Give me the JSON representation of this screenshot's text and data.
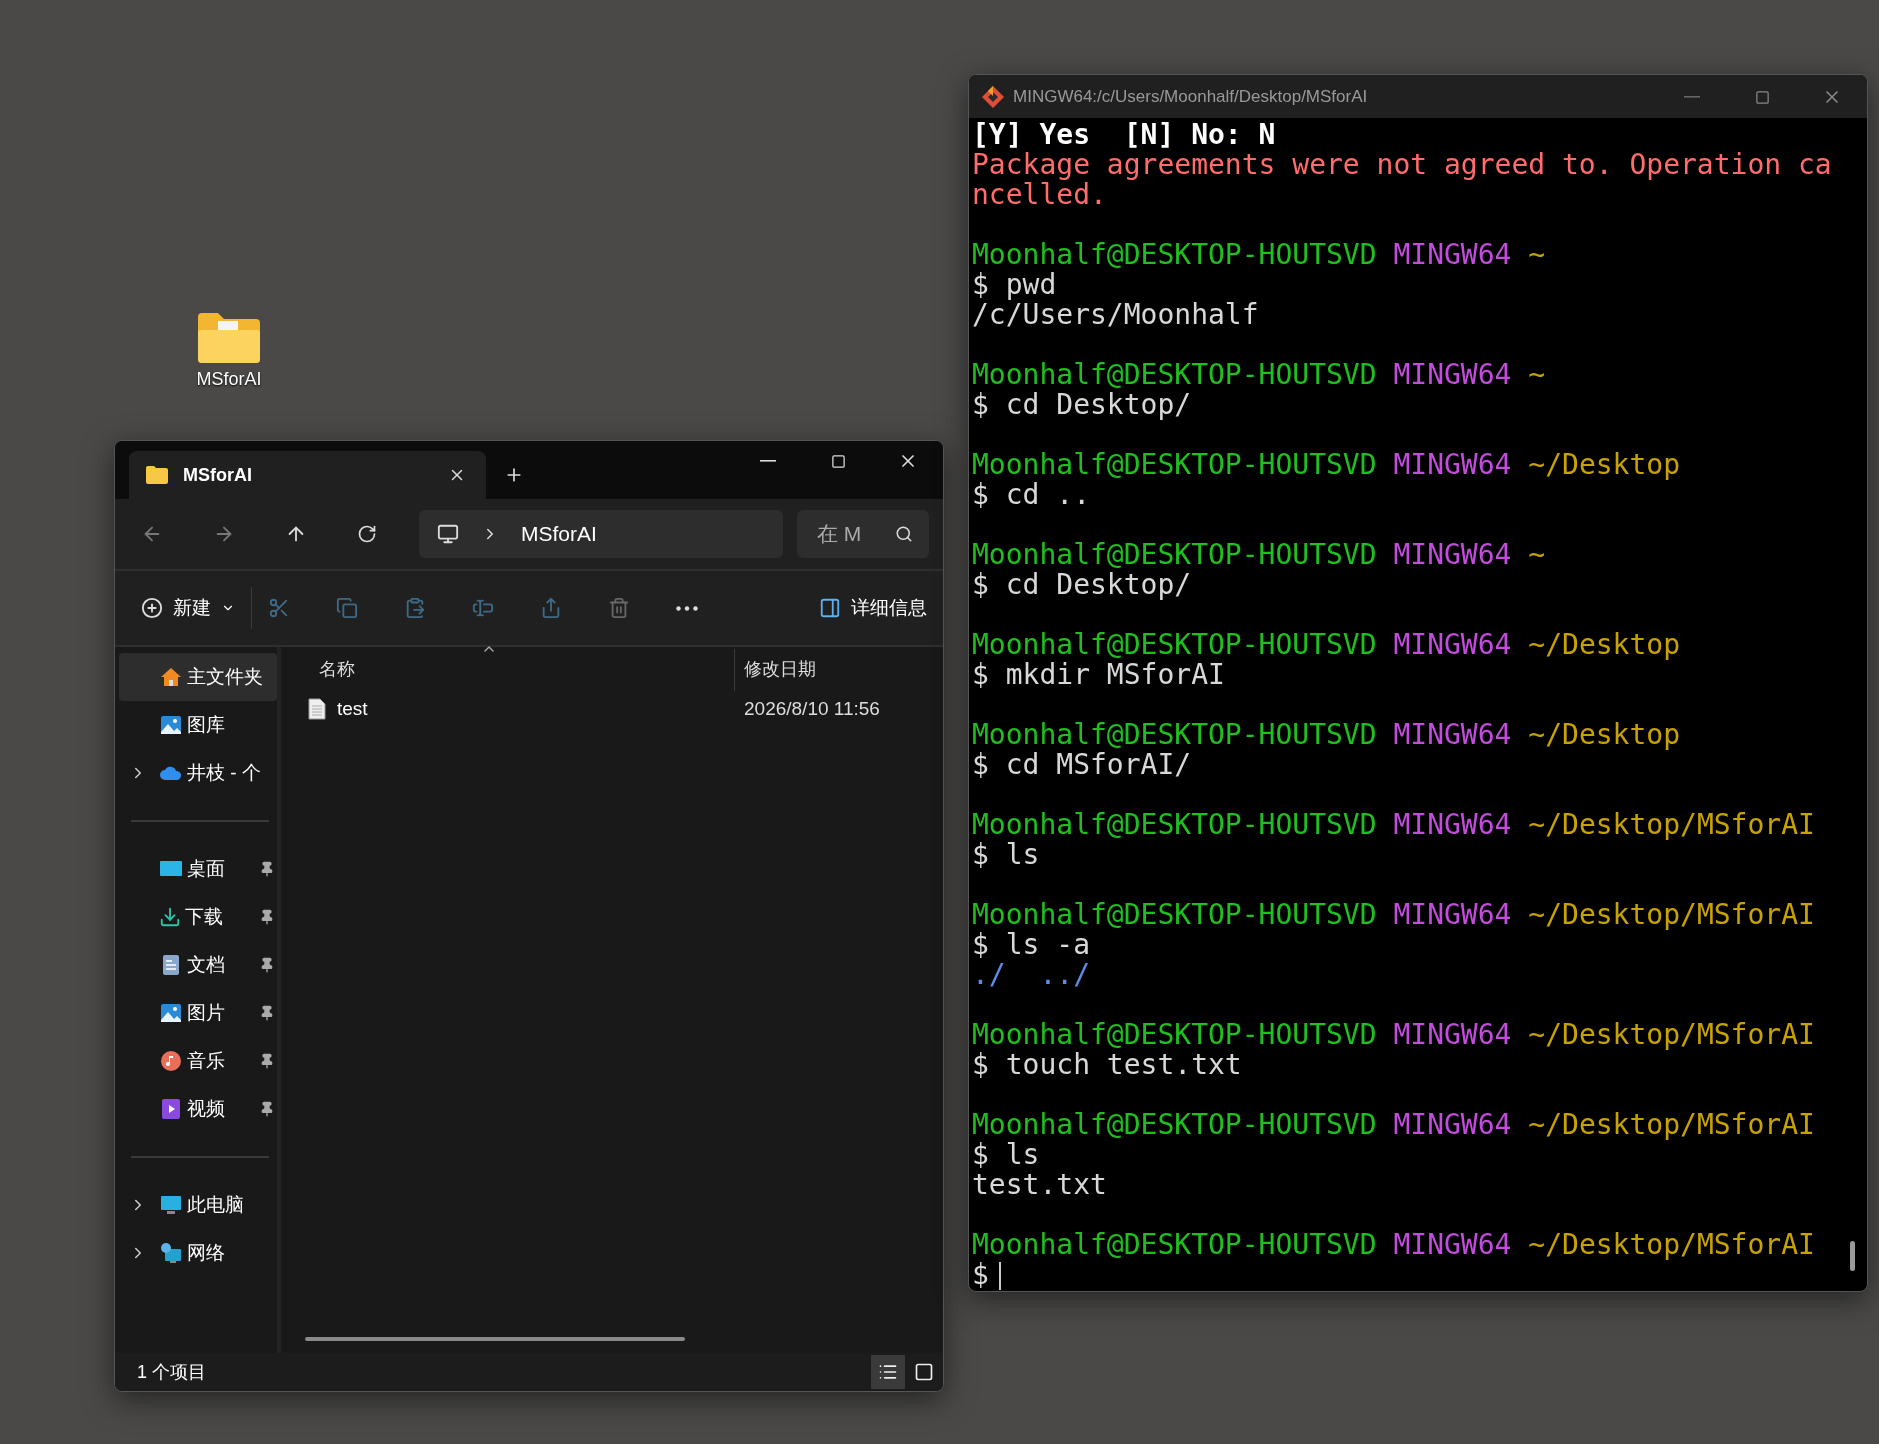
{
  "desktop": {
    "icons": [
      {
        "label": "MSforAI"
      }
    ]
  },
  "explorer": {
    "tabs": [
      {
        "label": "MSforAI",
        "selected": true
      }
    ],
    "address": {
      "crumbs": [
        "MSforAI"
      ]
    },
    "search": {
      "placeholder": "在 M"
    },
    "toolbar": {
      "new_label": "新建",
      "details_label": "详细信息"
    },
    "sidebar": [
      {
        "label": "主文件夹",
        "selected": true,
        "pinned": false,
        "has_children": false
      },
      {
        "label": "图库",
        "selected": false,
        "pinned": false,
        "has_children": false
      },
      {
        "label": "井枝 - 个",
        "selected": false,
        "pinned": false,
        "has_children": true
      },
      {
        "label": "桌面",
        "selected": false,
        "pinned": true,
        "has_children": false
      },
      {
        "label": "下载",
        "selected": false,
        "pinned": true,
        "has_children": false
      },
      {
        "label": "文档",
        "selected": false,
        "pinned": true,
        "has_children": false
      },
      {
        "label": "图片",
        "selected": false,
        "pinned": true,
        "has_children": false
      },
      {
        "label": "音乐",
        "selected": false,
        "pinned": true,
        "has_children": false
      },
      {
        "label": "视频",
        "selected": false,
        "pinned": true,
        "has_children": false
      },
      {
        "label": "此电脑",
        "selected": false,
        "pinned": false,
        "has_children": true
      },
      {
        "label": "网络",
        "selected": false,
        "pinned": false,
        "has_children": true
      }
    ],
    "columns": [
      "名称",
      "修改日期"
    ],
    "rows": [
      {
        "name": "test",
        "modified": "2026/8/10 11:56"
      }
    ],
    "status": "1 个项目",
    "views": [
      {
        "kind": "details",
        "selected": true
      },
      {
        "kind": "tiles",
        "selected": false
      }
    ]
  },
  "terminal": {
    "title": "MINGW64:/c/Users/Moonhalf/Desktop/MSforAI",
    "intro": [
      {
        "kind": "bold",
        "text": "[Y] Yes  [N] No: N"
      },
      {
        "kind": "error",
        "text": "Package agreements were not agreed to. Operation ca"
      },
      {
        "kind": "error",
        "text": "ncelled."
      }
    ],
    "sessions": [
      {
        "user": "Moonhalf@DESKTOP-HOUTSVD",
        "shell": "MINGW64",
        "path": "~",
        "command": "$ pwd",
        "output": [
          {
            "kind": "text",
            "text": "/c/Users/Moonhalf"
          }
        ]
      },
      {
        "user": "Moonhalf@DESKTOP-HOUTSVD",
        "shell": "MINGW64",
        "path": "~",
        "command": "$ cd Desktop/"
      },
      {
        "user": "Moonhalf@DESKTOP-HOUTSVD",
        "shell": "MINGW64",
        "path": "~/Desktop",
        "command": "$ cd .."
      },
      {
        "user": "Moonhalf@DESKTOP-HOUTSVD",
        "shell": "MINGW64",
        "path": "~",
        "command": "$ cd Desktop/"
      },
      {
        "user": "Moonhalf@DESKTOP-HOUTSVD",
        "shell": "MINGW64",
        "path": "~/Desktop",
        "command": "$ mkdir MSforAI"
      },
      {
        "user": "Moonhalf@DESKTOP-HOUTSVD",
        "shell": "MINGW64",
        "path": "~/Desktop",
        "command": "$ cd MSforAI/"
      },
      {
        "user": "Moonhalf@DESKTOP-HOUTSVD",
        "shell": "MINGW64",
        "path": "~/Desktop/MSforAI",
        "command": "$ ls"
      },
      {
        "user": "Moonhalf@DESKTOP-HOUTSVD",
        "shell": "MINGW64",
        "path": "~/Desktop/MSforAI",
        "command": "$ ls -a",
        "output": [
          {
            "kind": "dir",
            "text": "./  ../"
          }
        ]
      },
      {
        "user": "Moonhalf@DESKTOP-HOUTSVD",
        "shell": "MINGW64",
        "path": "~/Desktop/MSforAI",
        "command": "$ touch test.txt"
      },
      {
        "user": "Moonhalf@DESKTOP-HOUTSVD",
        "shell": "MINGW64",
        "path": "~/Desktop/MSforAI",
        "command": "$ ls",
        "output": [
          {
            "kind": "text",
            "text": "test.txt"
          }
        ]
      },
      {
        "user": "Moonhalf@DESKTOP-HOUTSVD",
        "shell": "MINGW64",
        "path": "~/Desktop/MSforAI",
        "command": "$",
        "cursor": true
      }
    ]
  }
}
